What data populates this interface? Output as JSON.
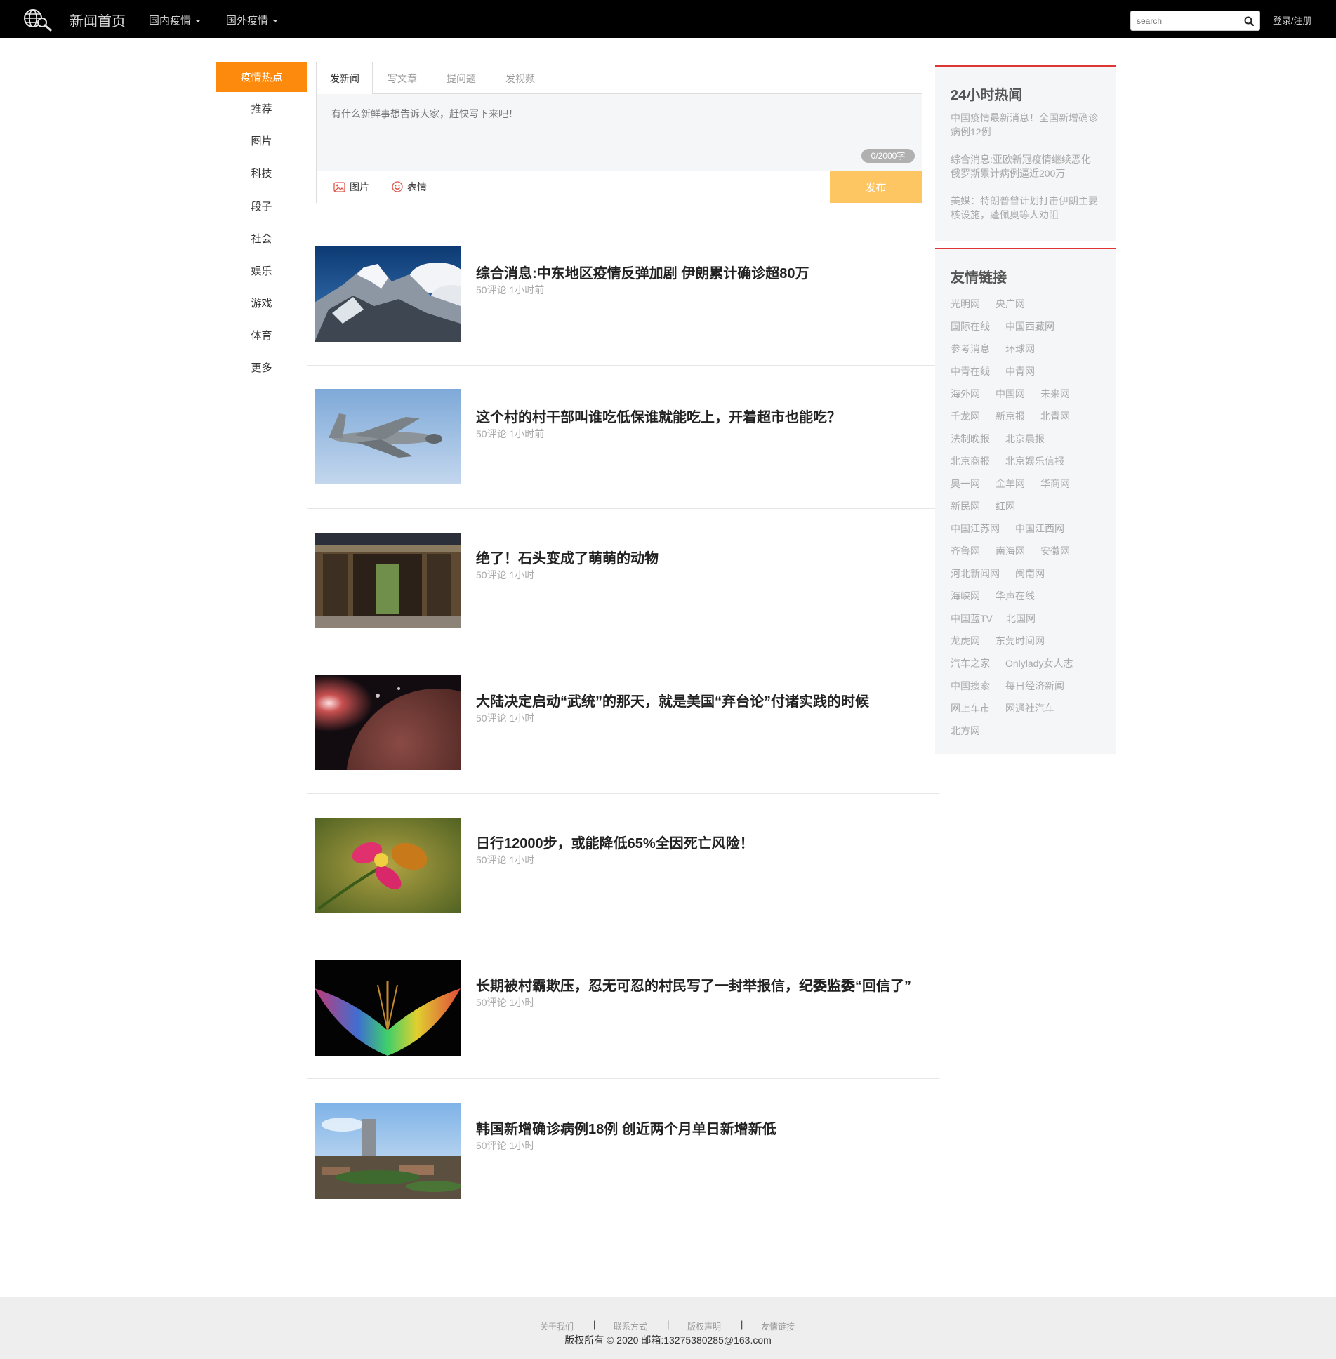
{
  "navbar": {
    "brand": "新闻首页",
    "dropdowns": [
      "国内疫情",
      "国外疫情"
    ],
    "search_placeholder": "search",
    "login": "登录/注册"
  },
  "sidebar": {
    "active": "疫情热点",
    "items": [
      "推荐",
      "图片",
      "科技",
      "段子",
      "社会",
      "娱乐",
      "游戏",
      "体育",
      "更多"
    ]
  },
  "composer": {
    "tabs": [
      "发新闻",
      "写文章",
      "提问题",
      "发视频"
    ],
    "placeholder": "有什么新鲜事想告诉大家，赶快写下来吧！",
    "counter": "0/2000字",
    "image_label": "图片",
    "emoji_label": "表情",
    "publish_label": "发布"
  },
  "news": [
    {
      "title": "综合消息:中东地区疫情反弹加剧 伊朗累计确诊超80万",
      "meta": "50评论 1小时前",
      "thumb": "mountain"
    },
    {
      "title": "这个村的村干部叫谁吃低保谁就能吃上，开着超市也能吃？",
      "meta": "50评论 1小时前",
      "thumb": "airplane"
    },
    {
      "title": "绝了！石头变成了萌萌的动物",
      "meta": "50评论 1小时",
      "thumb": "temple"
    },
    {
      "title": "大陆决定启动“武统”的那天，就是美国“弃台论”付诸实践的时候",
      "meta": "50评论 1小时",
      "thumb": "planet"
    },
    {
      "title": "日行12000步，或能降低65%全因死亡风险！",
      "meta": "50评论 1小时",
      "thumb": "butterfly"
    },
    {
      "title": "长期被村霸欺压，忍无可忍的村民写了一封举报信，纪委监委“回信了”",
      "meta": "50评论 1小时",
      "thumb": "flower"
    },
    {
      "title": "韩国新增确诊病例18例 创近两个月单日新增新低",
      "meta": "50评论 1小时",
      "thumb": "city"
    }
  ],
  "hot24": {
    "title": "24小时热闻",
    "items": [
      "中国疫情最新消息！全国新增确诊病例12例",
      "综合消息:亚欧新冠疫情继续恶化 俄罗斯累计病例逼近200万",
      "美媒：特朗普曾计划打击伊朗主要核设施，蓬佩奥等人劝阻"
    ]
  },
  "friend_links": {
    "title": "友情链接",
    "rows": [
      [
        "光明网",
        "央广网"
      ],
      [
        "国际在线",
        "中国西藏网"
      ],
      [
        "参考消息",
        "环球网"
      ],
      [
        "中青在线",
        "中青网"
      ],
      [
        "海外网",
        "中国网",
        "未来网"
      ],
      [
        "千龙网",
        "新京报",
        "北青网"
      ],
      [
        "法制晚报",
        "北京晨报"
      ],
      [
        "北京商报",
        "北京娱乐信报"
      ],
      [
        "奥一网",
        "金羊网",
        "华商网"
      ],
      [
        "新民网",
        "红网"
      ],
      [
        "中国江苏网",
        "中国江西网"
      ],
      [
        "齐鲁网",
        "南海网",
        "安徽网"
      ],
      [
        "河北新闻网",
        "闽南网"
      ],
      [
        "海峡网",
        "华声在线"
      ],
      [
        "中国蓝TV",
        "北国网"
      ],
      [
        "龙虎网",
        "东莞时间网"
      ],
      [
        "汽车之家",
        "Onlylady女人志"
      ],
      [
        "中国搜索",
        "每日经济新闻"
      ],
      [
        "网上车市",
        "网通社汽车"
      ],
      [
        "北方网"
      ]
    ]
  },
  "footer": {
    "links": [
      "关于我们",
      "联系方式",
      "版权声明",
      "友情链接"
    ],
    "separator": "|",
    "copyright": "版权所有 © 2020  邮箱:13275380285@163.com"
  },
  "colors": {
    "navbar_bg": "#000000",
    "accent_orange": "#fd8a0c",
    "publish_btn": "#fec662",
    "panel_top_border": "#e03535",
    "panel_bg": "#f5f6f7",
    "footer_bg": "#eeeeee"
  }
}
